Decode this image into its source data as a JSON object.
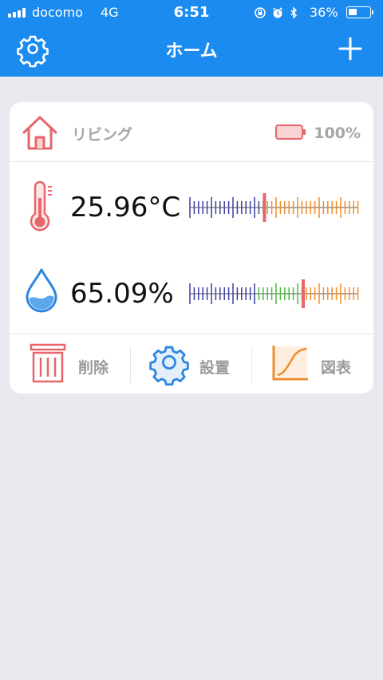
{
  "status_bar": {
    "carrier": "docomo",
    "network": "4G",
    "time": "6:51",
    "battery_percent": "36%"
  },
  "nav": {
    "title": "ホーム",
    "left_icon": "gear-icon",
    "right_icon": "plus-icon"
  },
  "device": {
    "room_name": "リビング",
    "battery": "100%",
    "temperature": "25.96°C",
    "humidity": "65.09%"
  },
  "actions": {
    "delete_label": "削除",
    "settings_label": "設置",
    "chart_label": "図表"
  },
  "colors": {
    "nav_bar": "#1b8bf0",
    "icon_red": "#e8666a",
    "gauge_blue": "#3b3f9c",
    "gauge_green": "#4cbc3c",
    "gauge_orange": "#f08d2a",
    "icon_blue": "#2c86e0"
  }
}
